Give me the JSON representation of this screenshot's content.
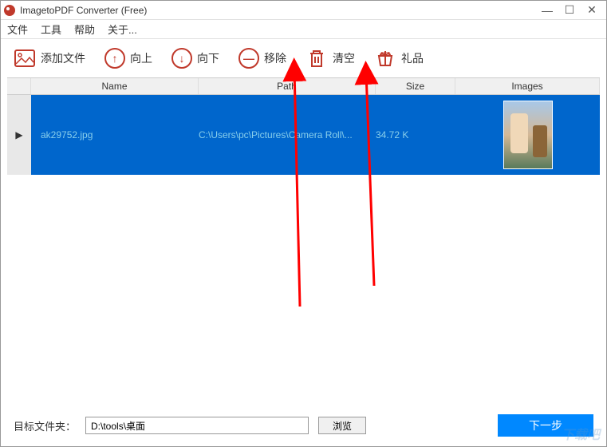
{
  "title": "ImagetoPDF Converter (Free)",
  "menu": {
    "file": "文件",
    "tools": "工具",
    "help": "帮助",
    "about": "关于..."
  },
  "toolbar": {
    "add": "添加文件",
    "up": "向上",
    "down": "向下",
    "remove": "移除",
    "clear": "清空",
    "gift": "礼品"
  },
  "headers": {
    "name": "Name",
    "path": "Path",
    "size": "Size",
    "images": "Images"
  },
  "row": {
    "marker": "▶",
    "name": "ak29752.jpg",
    "path": "C:\\Users\\pc\\Pictures\\Camera Roll\\...",
    "size": "34.72 K"
  },
  "bottom": {
    "label": "目标文件夹：",
    "path": "D:\\tools\\桌面",
    "browse": "浏览",
    "next": "下一步"
  },
  "watermark": "下载吧"
}
